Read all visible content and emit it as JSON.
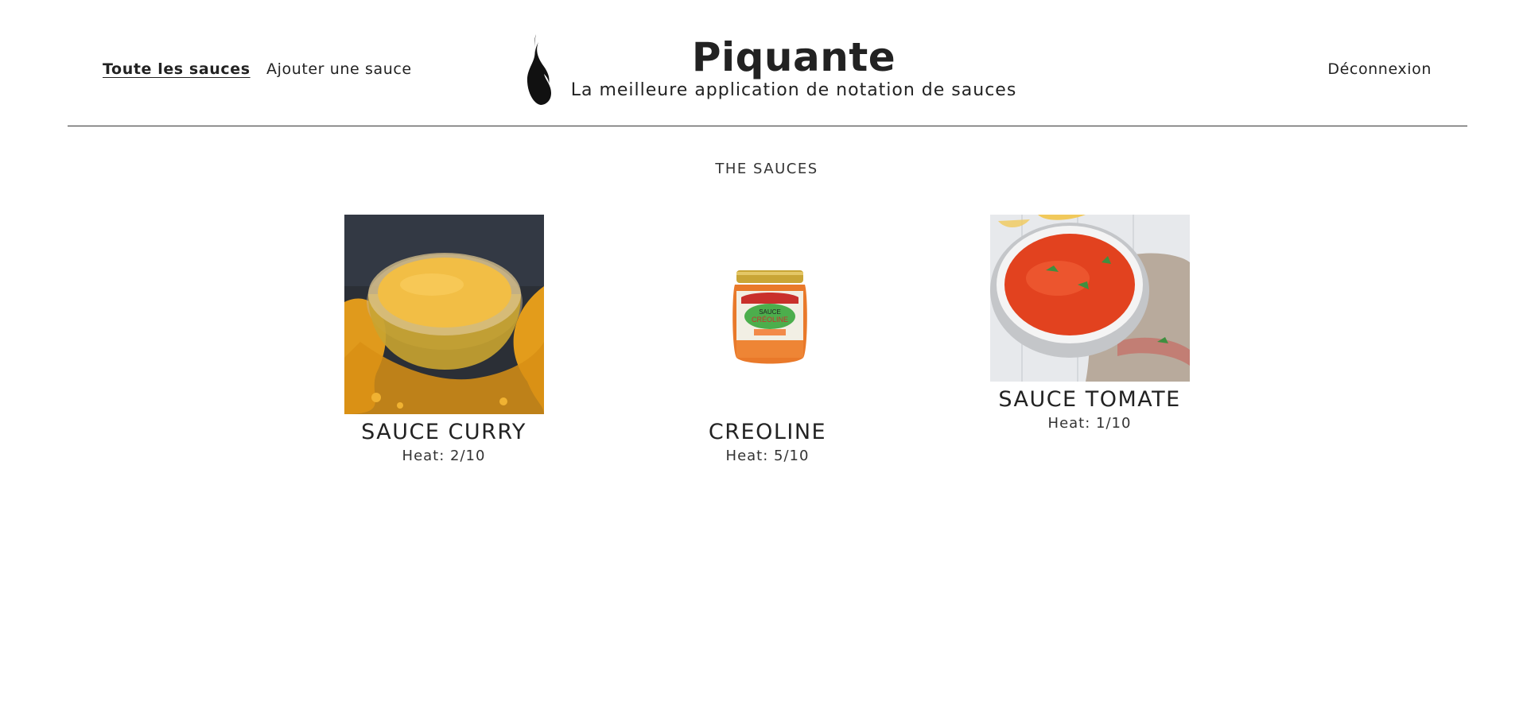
{
  "header": {
    "nav": {
      "all_sauces": "Toute les sauces",
      "add_sauce": "Ajouter une sauce",
      "logout": "Déconnexion"
    },
    "title": "Piquante",
    "subtitle": "La meilleure application de notation de sauces",
    "logo_icon": "flame-icon"
  },
  "main": {
    "section_title": "THE SAUCES",
    "sauces": [
      {
        "name": "SAUCE CURRY",
        "heat": "Heat: 2/10",
        "image_icon": "curry-sauce-bowl-image"
      },
      {
        "name": "CREOLINE",
        "heat": "Heat: 5/10",
        "image_icon": "creoline-jar-image"
      },
      {
        "name": "SAUCE TOMATE",
        "heat": "Heat: 1/10",
        "image_icon": "tomato-soup-bowl-image"
      }
    ]
  },
  "colors": {
    "text": "#222222",
    "background": "#ffffff",
    "divider": "#333333"
  }
}
